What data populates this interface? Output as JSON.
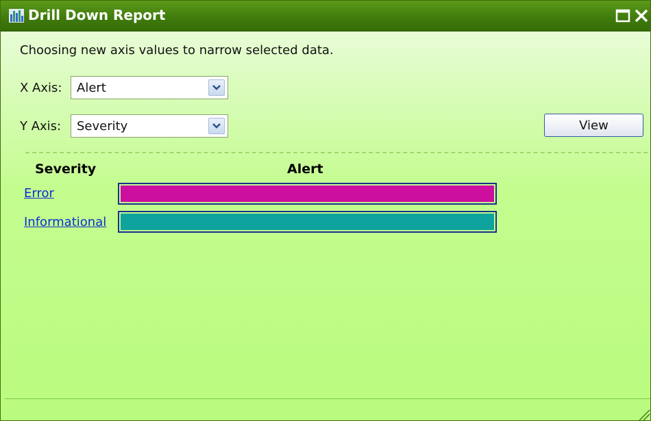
{
  "window": {
    "title": "Drill Down Report",
    "icon": "bar-chart-icon",
    "controls": [
      "maximize-icon",
      "close-icon"
    ]
  },
  "description": "Choosing new axis values to narrow selected data.",
  "x_axis": {
    "label": "X Axis:",
    "selected": "Alert"
  },
  "y_axis": {
    "label": "Y Axis:",
    "selected": "Severity"
  },
  "view_button": {
    "label": "View"
  },
  "chart_data": {
    "type": "bar",
    "orientation": "horizontal",
    "row_header": "Severity",
    "value_header": "Alert",
    "categories": [
      "Error",
      "Informational"
    ],
    "values": [
      1,
      1
    ],
    "colors": [
      "#cc0f9f",
      "#0ea39c"
    ]
  },
  "colors": {
    "titlebar": "#3f7a0c",
    "background": "#c4fc8f",
    "link": "#0b2fd6"
  }
}
